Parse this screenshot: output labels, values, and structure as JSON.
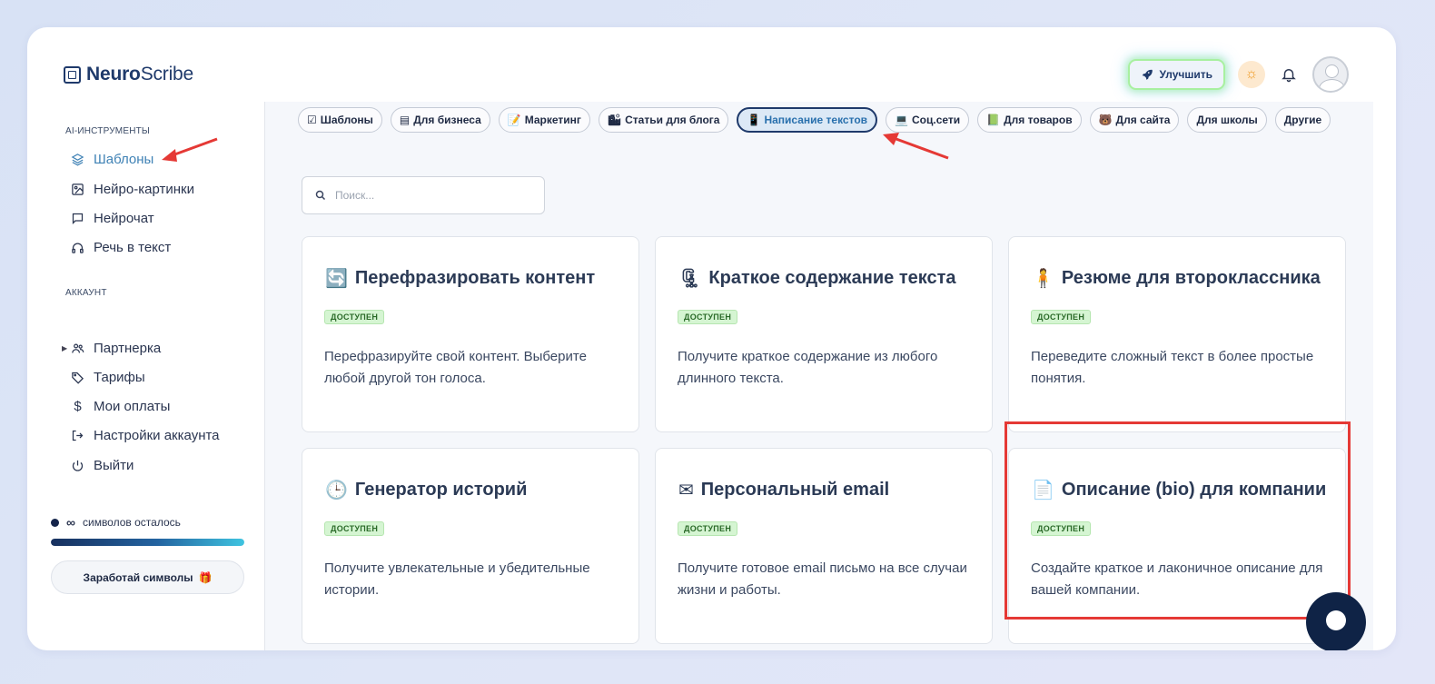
{
  "app": {
    "name_bold": "Neuro",
    "name_rest": "Scribe"
  },
  "header": {
    "upgrade_label": "Улучшить"
  },
  "sidebar": {
    "section_tools": "AI-ИНСТРУМЕНТЫ",
    "section_account": "АККАУНТ",
    "tools": [
      {
        "label": "Шаблоны",
        "icon": "layers-icon"
      },
      {
        "label": "Нейро-картинки",
        "icon": "image-icon"
      },
      {
        "label": "Нейрочат",
        "icon": "chat-icon"
      },
      {
        "label": "Речь в текст",
        "icon": "headphones-icon"
      }
    ],
    "account": [
      {
        "label": "Партнерка",
        "icon": "users-icon"
      },
      {
        "label": "Тарифы",
        "icon": "tag-icon"
      },
      {
        "label": "Мои оплаты",
        "icon": "dollar-icon"
      },
      {
        "label": "Настройки аккаунта",
        "icon": "login-icon"
      },
      {
        "label": "Выйти",
        "icon": "power-icon"
      }
    ],
    "credits_symbol": "∞",
    "credits_text": "символов осталось",
    "credits_fraction": 1.0,
    "earn_label": "Заработай символы"
  },
  "chips": [
    {
      "icon": "☑",
      "label": "Шаблоны"
    },
    {
      "icon": "▤",
      "label": "Для бизнеса"
    },
    {
      "icon": "📝",
      "label": "Маркетинг"
    },
    {
      "icon": "🏙",
      "label": "Статьи для блога"
    },
    {
      "icon": "📱",
      "label": "Написание текстов",
      "active": true
    },
    {
      "icon": "💻",
      "label": "Соц.сети"
    },
    {
      "icon": "📗",
      "label": "Для товаров"
    },
    {
      "icon": "🐻",
      "label": "Для сайта"
    },
    {
      "icon": "",
      "label": "Для школы"
    },
    {
      "icon": "",
      "label": "Другие"
    }
  ],
  "search": {
    "placeholder": "Поиск..."
  },
  "cards": [
    {
      "icon": "🔄",
      "title": "Перефразировать контент",
      "badge": "ДОСТУПЕН",
      "desc": "Перефразируйте свой контент. Выберите любой другой тон голоса."
    },
    {
      "icon": "🗜",
      "title": "Краткое содержание текста",
      "badge": "ДОСТУПЕН",
      "desc": "Получите краткое содержание из любого длинного текста."
    },
    {
      "icon": "🧍",
      "title": "Резюме для второклассника",
      "badge": "ДОСТУПЕН",
      "desc": "Переведите сложный текст в более простые понятия."
    },
    {
      "icon": "🕒",
      "title": "Генератор историй",
      "badge": "ДОСТУПЕН",
      "desc": "Получите увлекательные и убедительные истории."
    },
    {
      "icon": "✉",
      "title": "Персональный email",
      "badge": "ДОСТУПЕН",
      "desc": "Получите готовое email письмо на все случаи жизни и работы."
    },
    {
      "icon": "📄",
      "title": "Описание (bio) для компании",
      "badge": "ДОСТУПЕН",
      "desc": "Создайте краткое и лаконичное описание для вашей компании."
    }
  ],
  "colors": {
    "accent": "#3f82b5",
    "annotation": "#e53935",
    "badge_bg": "#d5f5d2",
    "brand_dark": "#1f3a6b"
  }
}
